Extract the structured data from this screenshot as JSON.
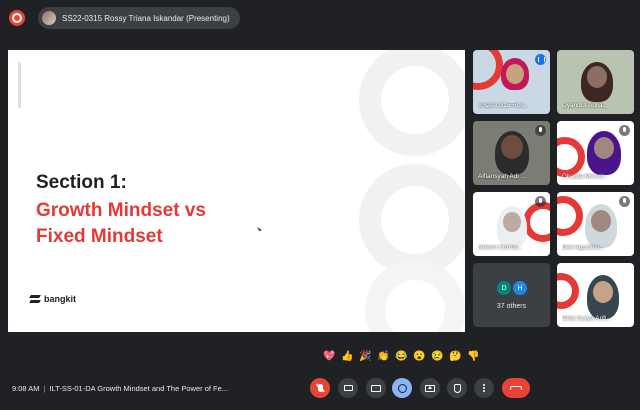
{
  "header": {
    "presenter_label": "SS22-0315 Rossy Triana Iskandar (Presenting)"
  },
  "slide": {
    "section": "Section 1:",
    "title_line1": "Growth Mindset vs",
    "title_line2": "Fixed Mindset",
    "logo_text": "bangkit",
    "accent_color": "#e53935"
  },
  "participants": [
    {
      "name": "SS22-0315 Ros...",
      "state": "speaking"
    },
    {
      "name": "Dyandra Aulia...",
      "state": "video"
    },
    {
      "name": "Alfiansyah Adi ...",
      "state": "muted"
    },
    {
      "name": "Ghaida Musvir...",
      "state": "muted"
    },
    {
      "name": "Neken Kurnia...",
      "state": "muted"
    },
    {
      "name": "Dwi Agustina...",
      "state": "muted"
    },
    {
      "name": "Dika Surya Arifi...",
      "state": "muted"
    }
  ],
  "others": {
    "initials": [
      "D",
      "H"
    ],
    "label": "37 others"
  },
  "reactions": [
    "💖",
    "👍",
    "🎉",
    "👏",
    "😂",
    "😮",
    "😢",
    "🤔",
    "👎"
  ],
  "footer": {
    "time": "9:08 AM",
    "meeting_title": "ILT-SS-01-DA Growth Mindset and The Power of Fe..."
  },
  "colors": {
    "background": "#202124",
    "end_call": "#ea4335",
    "mic_muted": "#ea4335",
    "reaction_active": "#8ab4f8"
  }
}
